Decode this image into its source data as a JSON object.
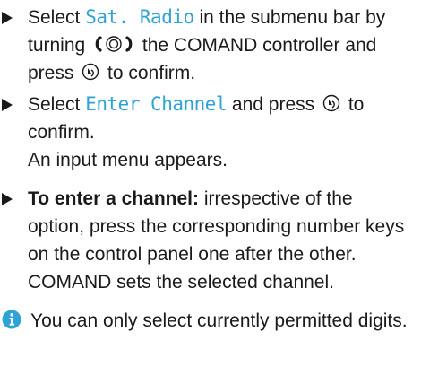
{
  "steps": [
    {
      "pre": "Select ",
      "term": "Sat. Radio",
      "mid": " in the submenu bar by turning ",
      "post_turn": " the COMAND controller and press ",
      "post_press": " to confirm."
    },
    {
      "pre": "Select ",
      "term": "Enter Channel",
      "mid": " and press ",
      "post_press": " to confirm.",
      "result": "An input menu appears."
    },
    {
      "bold": "To enter a channel:",
      "text": " irrespective of the option, press the corresponding number keys on the control panel one after the other.",
      "result": "COMAND sets the selected channel."
    }
  ],
  "note": {
    "icon": "info-icon",
    "text": "You can only select currently permitted digits."
  },
  "colors": {
    "ui_term": "#2fa3d6",
    "text": "#1a1a1a"
  }
}
